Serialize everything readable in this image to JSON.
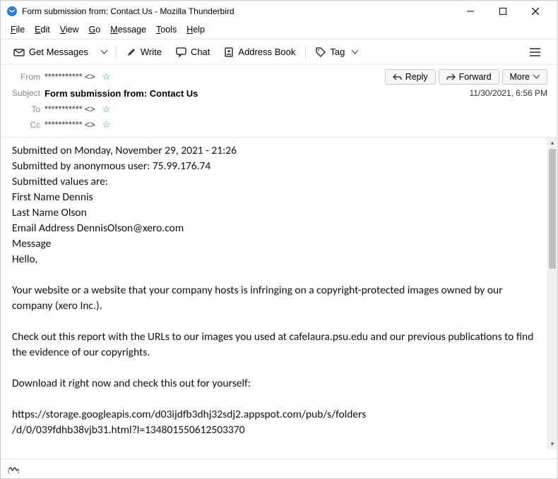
{
  "titlebar": {
    "title": "Form submission from: Contact Us - Mozilla Thunderbird"
  },
  "menubar": {
    "file": "File",
    "edit": "Edit",
    "view": "View",
    "go": "Go",
    "message": "Message",
    "tools": "Tools",
    "help": "Help"
  },
  "toolbar": {
    "get_messages": "Get Messages",
    "write": "Write",
    "chat": "Chat",
    "address_book": "Address Book",
    "tag": "Tag"
  },
  "headers": {
    "from_label": "From",
    "from_value": "*********** <>",
    "subject_label": "Subject",
    "subject_value": "Form submission from: Contact Us",
    "to_label": "To",
    "to_value": "*********** <>",
    "cc_label": "Cc",
    "cc_value": "*********** <>",
    "date": "11/30/2021, 6:56 PM"
  },
  "actions": {
    "reply": "Reply",
    "forward": "Forward",
    "more": "More"
  },
  "body": {
    "l1": "Submitted on Monday, November 29, 2021 - 21:26",
    "l2": "Submitted by anonymous user: 75.99.176.74",
    "l3": "Submitted values are:",
    "l4": "First Name Dennis",
    "l5": "Last Name Olson",
    "l6": "Email Address DennisOlson@xero.com",
    "l7": "Message",
    "l8": "Hello,",
    "l9": "Your website or a website that your company hosts is infringing on a copyright-protected images owned by our company (xero Inc.).",
    "l10": "Check out this report with the URLs to our images you used at cafelaura.psu.edu and our previous publications to find the evidence of our copyrights.",
    "l11": "Download it right now and check this out for yourself:",
    "l12": "https://storage.googleapis.com/d03ijdfb3dhj32sdj2.appspot.com/pub/s/folders",
    "l13": "/d/0/039fdhb38vjb31.html?l=134801550612503370"
  }
}
